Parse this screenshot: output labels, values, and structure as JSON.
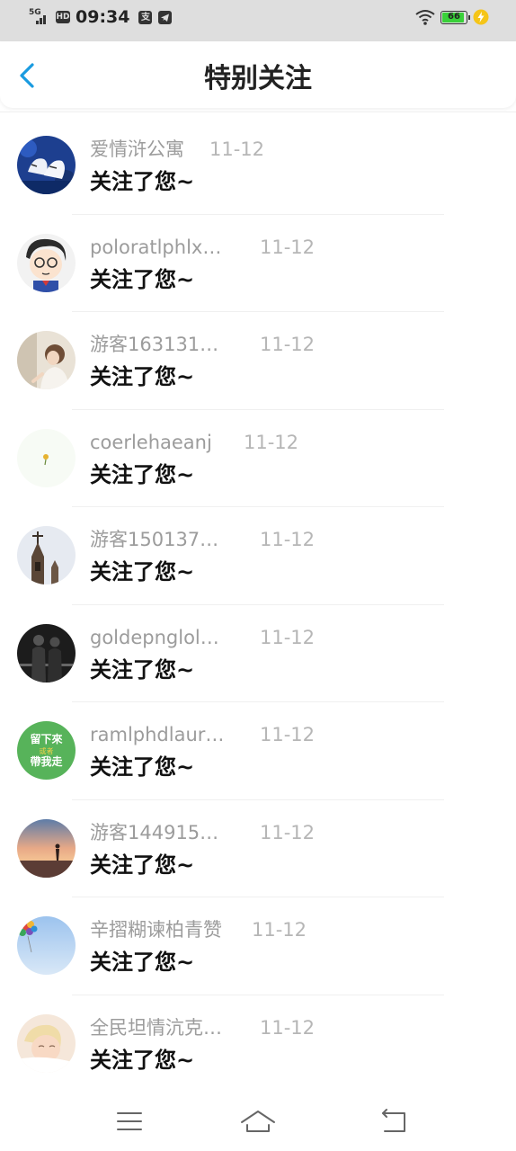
{
  "status_bar": {
    "network": "5G",
    "hd": "HD",
    "time": "09:34",
    "app_badge": "支",
    "battery_level": "66"
  },
  "header": {
    "title": "特别关注"
  },
  "notifications": [
    {
      "name": "爱情浒公寓",
      "date": "11-12",
      "message": "关注了您~"
    },
    {
      "name": "poloratlphlx…",
      "date": "11-12",
      "message": "关注了您~"
    },
    {
      "name": "游客163131…",
      "date": "11-12",
      "message": "关注了您~"
    },
    {
      "name": "coerlehaeanj",
      "date": "11-12",
      "message": "关注了您~"
    },
    {
      "name": "游客150137…",
      "date": "11-12",
      "message": "关注了您~"
    },
    {
      "name": "goldepnglol…",
      "date": "11-12",
      "message": "关注了您~"
    },
    {
      "name": "ramlphdlaur…",
      "date": "11-12",
      "message": "关注了您~"
    },
    {
      "name": "游客144915…",
      "date": "11-12",
      "message": "关注了您~"
    },
    {
      "name": "辛摺糊谏柏青赞",
      "date": "11-12",
      "message": "关注了您~"
    },
    {
      "name": "全民坦情沆克…",
      "date": "11-12",
      "message": "关注了您~"
    }
  ],
  "avatar_badges": {
    "green_sign_line1": "留下來",
    "green_sign_line2": "或者",
    "green_sign_line3": "帶我走"
  },
  "colors": {
    "accent": "#1a9be0",
    "title": "#222222",
    "name": "#9c9c9c",
    "message": "#111111"
  },
  "nav": {
    "icons": [
      "menu-icon",
      "home-icon",
      "back-icon"
    ]
  }
}
